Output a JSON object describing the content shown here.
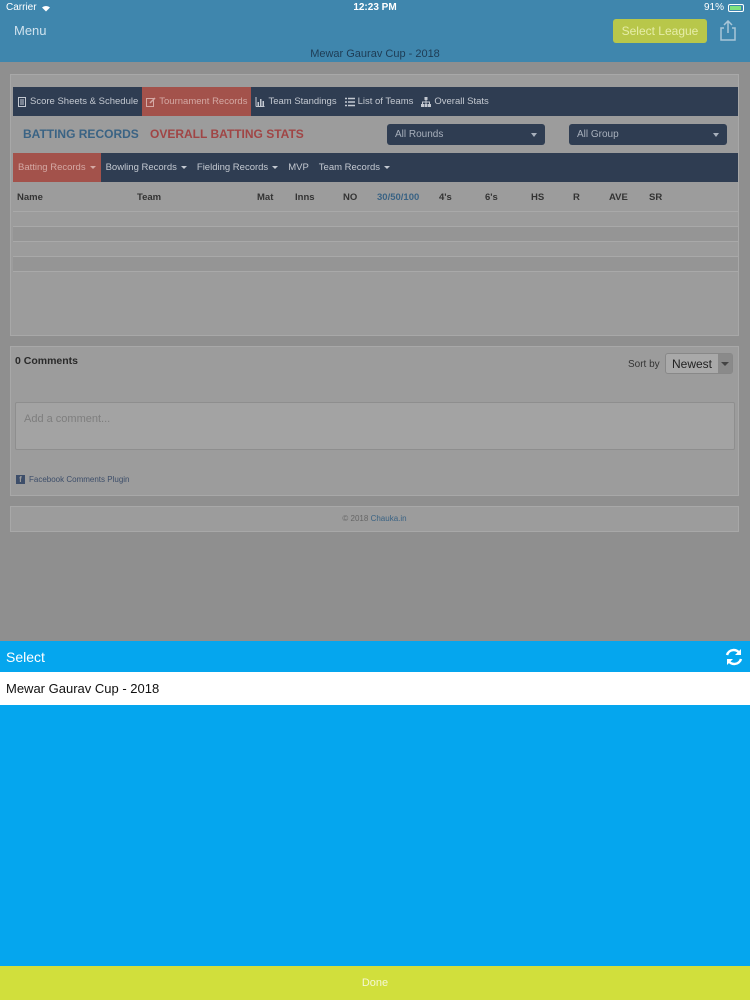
{
  "status": {
    "carrier": "Carrier",
    "time": "12:23 PM",
    "battery": "91%"
  },
  "nav": {
    "menu": "Menu",
    "select_league": "Select League"
  },
  "league_title": "Mewar Gaurav Cup - 2018",
  "top_tabs": [
    {
      "label": "Score Sheets & Schedule",
      "icon": "document-icon"
    },
    {
      "label": "Tournament Records",
      "icon": "edit-icon"
    },
    {
      "label": "Team Standings",
      "icon": "bar-chart-icon"
    },
    {
      "label": "List of Teams",
      "icon": "list-icon"
    },
    {
      "label": "Overall Stats",
      "icon": "sitemap-icon"
    }
  ],
  "headings": {
    "batting": "BATTING RECORDS",
    "overall": "OVERALL BATTING STATS"
  },
  "dropdowns": {
    "rounds": "All Rounds",
    "group": "All Group"
  },
  "sub_tabs": [
    "Batting Records",
    "Bowling Records",
    "Fielding Records",
    "MVP",
    "Team Records"
  ],
  "table_headers": [
    "Name",
    "Team",
    "Mat",
    "Inns",
    "NO",
    "30/50/100",
    "4's",
    "6's",
    "HS",
    "R",
    "AVE",
    "SR"
  ],
  "comments": {
    "count": "0 Comments",
    "sort_label": "Sort by",
    "sort_value": "Newest",
    "placeholder": "Add a comment...",
    "plugin": "Facebook Comments Plugin"
  },
  "footer": {
    "copyright": "© 2018",
    "link": "Chauka.in"
  },
  "picker": {
    "title": "Select",
    "option": "Mewar Gaurav Cup - 2018",
    "done": "Done"
  }
}
